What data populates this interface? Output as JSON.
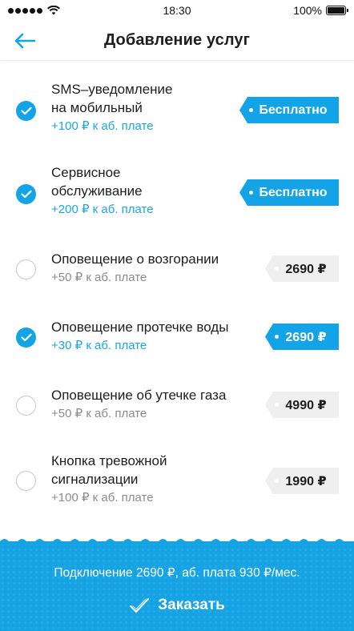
{
  "status_bar": {
    "time": "18:30",
    "battery": "100%"
  },
  "header": {
    "title": "Добавление услуг"
  },
  "services": [
    {
      "name": "SMS–уведомление\nна мобильный",
      "fee": "+100 ₽  к аб. плате",
      "price": "Бесплатно",
      "checked": true
    },
    {
      "name": "Сервисное\nобслуживание",
      "fee": "+200 ₽  к аб. плате",
      "price": "Бесплатно",
      "checked": true
    },
    {
      "name": "Оповещение о возгорании",
      "fee": "+50 ₽  к аб. плате",
      "price": "2690 ₽",
      "checked": false
    },
    {
      "name": "Оповещение протечке воды",
      "fee": "+30 ₽  к аб. плате",
      "price": "2690 ₽",
      "checked": true
    },
    {
      "name": "Оповещение об утечке газа",
      "fee": "+50 ₽  к аб. плате",
      "price": "4990 ₽",
      "checked": false
    },
    {
      "name": "Кнопка тревожной\nсигнализации",
      "fee": "+100 ₽  к аб. плате",
      "price": "1990 ₽",
      "checked": false
    }
  ],
  "footer": {
    "summary": "Подключение 2690 ₽, аб. плата 930 ₽/мес.",
    "order_label": "Заказать"
  },
  "colors": {
    "accent": "#12a4e6",
    "unchecked_tag": "#efefef",
    "muted_text": "#8c8c8c"
  },
  "icons": {
    "back": "arrow-left-icon",
    "check": "checkmark-icon",
    "order": "checkmark-outline-icon"
  }
}
